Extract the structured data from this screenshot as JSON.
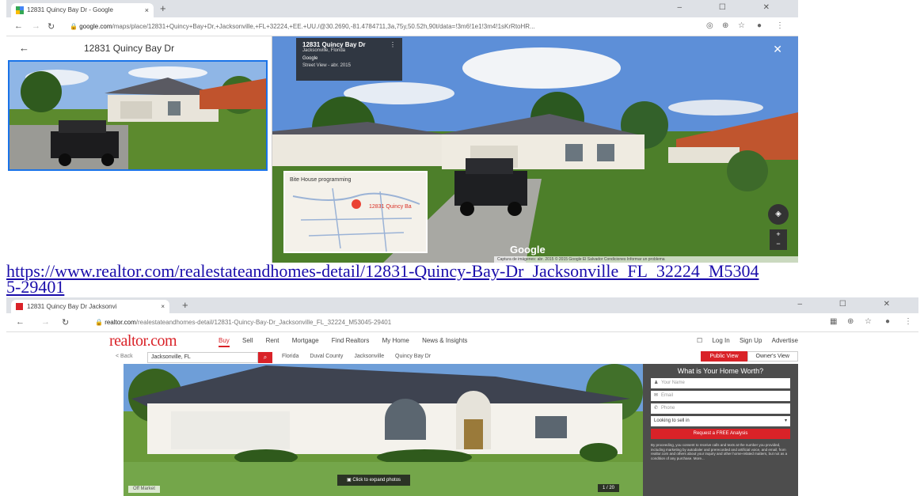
{
  "google_window": {
    "tab_title": "12831 Quincy Bay Dr - Google",
    "tab_close": "×",
    "new_tab": "+",
    "window_controls": "– ☐ ✕",
    "url_host": "google.com",
    "url_path": "/maps/place/12831+Quincy+Bay+Dr,+Jacksonville,+FL+32224,+EE.+UU./@30.2690,-81.4784711,3a,75y,50.52h,90t/data=!3m6!1e1!3m4!1sKrRtoHR...",
    "panel_title": "12831 Quincy Bay Dr",
    "street_view": {
      "card_title": "12831 Quincy Bay Dr",
      "card_subtitle": "Jacksonville, Florida",
      "card_source": "Google",
      "card_date": "Street View - abr. 2015",
      "map_label": "Bite House\nprogramming",
      "map_address": "12831 Quincy Ba",
      "logo": "Google",
      "footer": "Captura de imágenes: abr. 2015   © 2015 Google   El Salvador   Condiciones   Informar un problema"
    }
  },
  "link": {
    "text": "https://www.realtor.com/realestateandhomes-detail/12831-Quincy-Bay-Dr_Jacksonville_FL_32224_M53045-29401"
  },
  "realtor_window": {
    "tab_title": "12831 Quincy Bay Dr Jacksonvi",
    "tab_close": "×",
    "new_tab": "+",
    "window_controls": "– ☐ ✕",
    "url_host": "realtor.com",
    "url_path": "/realestateandhomes-detail/12831-Quincy-Bay-Dr_Jacksonville_FL_32224_M53045-29401",
    "logo": "realtor.com",
    "nav": [
      "Buy",
      "Sell",
      "Rent",
      "Mortgage",
      "Find Realtors",
      "My Home",
      "News & Insights"
    ],
    "right_nav": [
      "Log In",
      "Sign Up",
      "Advertise"
    ],
    "back": "< Back",
    "search_value": "Jacksonville, FL",
    "crumbs": [
      "Florida",
      "Duval County",
      "Jacksonville",
      "Quincy Bay Dr"
    ],
    "views": [
      "Public View",
      "Owner's View"
    ],
    "expand_label": "Click to expand photos",
    "photo_count": "1 / 20",
    "off_market": "Off Market",
    "form": {
      "title": "What is Your Home Worth?",
      "name": "Your Name",
      "email": "Email",
      "phone": "Phone",
      "select": "Looking to sell in",
      "button": "Request a FREE Analysis",
      "terms": "By proceeding, you consent to receive calls and texts at the number you provided, including marketing by autodialer and prerecorded and artificial voice, and email, from realtor.com and others about your inquiry and other home-related matters, but not as a condition of any purchase. More..."
    }
  },
  "colors": {
    "realtor_red": "#d92228",
    "link_blue": "#1a0dab",
    "form_bg": "#4d4d4d"
  }
}
